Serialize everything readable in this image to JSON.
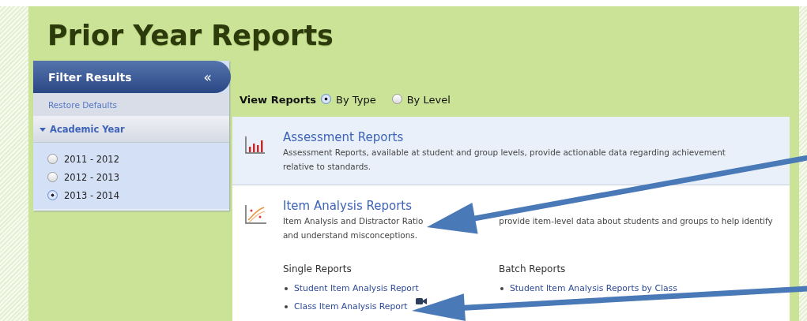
{
  "page_title": "Prior Year Reports",
  "filter": {
    "title": "Filter Results",
    "collapse": "«",
    "restore": "Restore Defaults",
    "section": {
      "label": "Academic Year",
      "expanded": true
    },
    "years": [
      {
        "label": "2011 - 2012",
        "selected": false
      },
      {
        "label": "2012 - 2013",
        "selected": false
      },
      {
        "label": "2013 - 2014",
        "selected": true
      }
    ]
  },
  "view_reports": {
    "label": "View Reports",
    "options": [
      {
        "label": "By Type",
        "selected": true
      },
      {
        "label": "By Level",
        "selected": false
      }
    ]
  },
  "reports": [
    {
      "kind": "bars",
      "title": "Assessment Reports",
      "description": [
        [
          "Assessment Reports, available at student and group levels, provide actionable data regarding achievement relative to standards."
        ]
      ],
      "highlighted": true
    },
    {
      "kind": "curve",
      "title": "Item Analysis Reports",
      "description": [
        [
          "Item Analysis and Distractor Ratio",
          "provide item-level data about students and groups to help identify"
        ],
        [
          "and understand misconceptions."
        ]
      ],
      "highlighted": false,
      "groups": [
        {
          "heading": "Single Reports",
          "links": [
            {
              "label": "Student Item Analysis Report",
              "video": false
            },
            {
              "label": "Class Item Analysis Report",
              "video": true
            }
          ]
        },
        {
          "heading": "Batch Reports",
          "links": [
            {
              "label": "Student Item Analysis Reports by Class",
              "video": false
            }
          ]
        }
      ]
    }
  ]
}
